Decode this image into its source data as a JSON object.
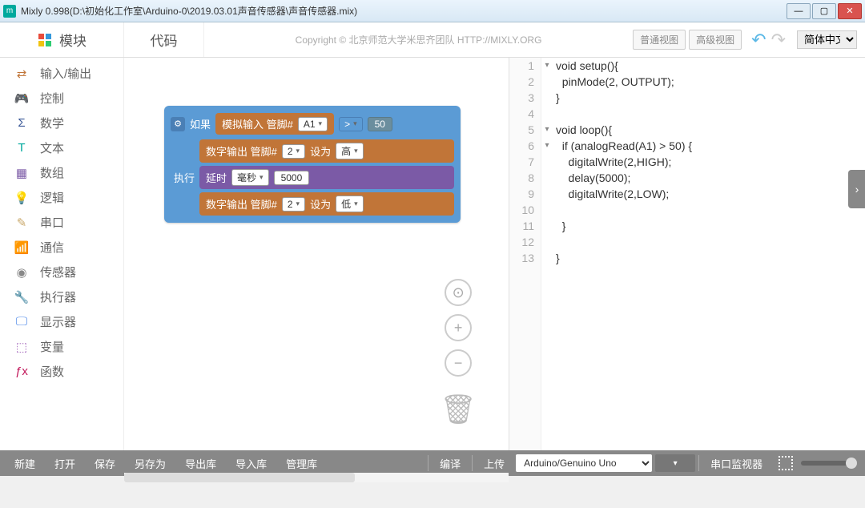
{
  "window": {
    "title": "Mixly 0.998(D:\\初始化工作室\\Arduino-0\\2019.03.01声音传感器\\声音传感器.mix)"
  },
  "tabs": {
    "modules": "模块",
    "code": "代码"
  },
  "copyright": "Copyright © 北京师范大学米思齐团队 HTTP://MIXLY.ORG",
  "viewButtons": {
    "normal": "普通视图",
    "advanced": "高级视图"
  },
  "language": "简体中文",
  "categories": [
    {
      "label": "输入/输出",
      "color": "#c17538",
      "icon": "⇄"
    },
    {
      "label": "控制",
      "color": "#5b9bd5",
      "icon": "🎮"
    },
    {
      "label": "数学",
      "color": "#3b5998",
      "icon": "∑"
    },
    {
      "label": "文本",
      "color": "#00a99d",
      "icon": "T"
    },
    {
      "label": "数组",
      "color": "#7b5aa6",
      "icon": "▦"
    },
    {
      "label": "逻辑",
      "color": "#3b9e3b",
      "icon": "💡"
    },
    {
      "label": "串口",
      "color": "#c9a86a",
      "icon": "✎"
    },
    {
      "label": "通信",
      "color": "#6aa84f",
      "icon": "📶"
    },
    {
      "label": "传感器",
      "color": "#888",
      "icon": "◉"
    },
    {
      "label": "执行器",
      "color": "#6aa84f",
      "icon": "🔧"
    },
    {
      "label": "显示器",
      "color": "#4a86e8",
      "icon": "🖵"
    },
    {
      "label": "变量",
      "color": "#9b59b6",
      "icon": "⬚"
    },
    {
      "label": "函数",
      "color": "#c2185b",
      "icon": "ƒx"
    }
  ],
  "blocks": {
    "if_label": "如果",
    "exec_label": "执行",
    "analog_read": "模拟输入 管脚#",
    "analog_pin": "A1",
    "compare_op": ">",
    "compare_val": "50",
    "digital_write": "数字输出 管脚#",
    "dw_pin1": "2",
    "dw_set": "设为",
    "dw_val_high": "高",
    "delay_label": "延时",
    "delay_unit": "毫秒",
    "delay_val": "5000",
    "dw_pin2": "2",
    "dw_val_low": "低"
  },
  "code": {
    "lines": [
      "void setup(){",
      "  pinMode(2, OUTPUT);",
      "}",
      "",
      "void loop(){",
      "  if (analogRead(A1) > 50) {",
      "    digitalWrite(2,HIGH);",
      "    delay(5000);",
      "    digitalWrite(2,LOW);",
      "",
      "  }",
      "",
      "}"
    ]
  },
  "bottom": {
    "new": "新建",
    "open": "打开",
    "save": "保存",
    "saveas": "另存为",
    "export": "导出库",
    "import": "导入库",
    "manage": "管理库",
    "compile": "编译",
    "upload": "上传",
    "board": "Arduino/Genuino Uno",
    "serial_monitor": "串口监视器"
  }
}
